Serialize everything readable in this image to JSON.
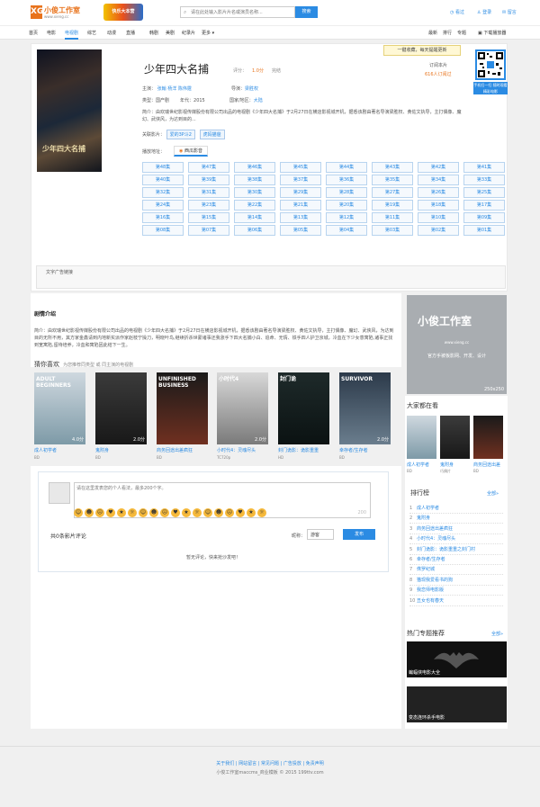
{
  "header": {
    "logo_text": "小俊工作室",
    "logo_sub": "www.xieng.cc",
    "banner_text": "快乐大本营",
    "search_placeholder": "请在此处输入影片片名或演员名称...",
    "search_button": "搜索",
    "links": [
      "看过",
      "登录",
      "留言"
    ]
  },
  "nav": {
    "items": [
      "首页",
      "电影",
      "电视剧",
      "综艺",
      "动漫",
      "直播",
      "韩剧",
      "美剧",
      "纪录片",
      "更多 ▾"
    ],
    "active": "电视剧",
    "right": [
      "最新",
      "排行",
      "专题",
      "下载播放器"
    ]
  },
  "detail": {
    "title": "少年四大名捕",
    "poster_text": "少年四大名捕",
    "score_label": "评分：",
    "score": "1.0分",
    "status": "完结",
    "remind": "一键收藏，每天提醒更新",
    "subs_label": "订阅本片",
    "subs_count": "616人订阅过",
    "qr_label": "手机扫一扫 随时观看精彩电影",
    "cast_label": "主演：",
    "cast": [
      "张翰",
      "杨洋",
      "陈伟霆"
    ],
    "director_label": "导演：",
    "director": "梁胜权",
    "type_label": "类型：",
    "type": "国产剧",
    "year_label": "年代：",
    "year": "2015",
    "region_label": "国家/地区：",
    "region": "大陆",
    "intro": "简介：由欢瑞世纪影视传媒股份有限公司出品的电视剧《少年四大名捕》于2月27日在横店影视城开机，据悉该剧由著名导演梁胜权、黄佐文执导，主打偶像、魔幻、武侠风，为达到目的...",
    "related_label": "关联影片：",
    "related": [
      "爱的3P斗2",
      "虎妈猫爸"
    ],
    "source_label": "播放地址：",
    "source": "西瓜影音",
    "episodes": [
      "第48集",
      "第47集",
      "第46集",
      "第45集",
      "第44集",
      "第43集",
      "第42集",
      "第41集",
      "第40集",
      "第39集",
      "第38集",
      "第37集",
      "第36集",
      "第35集",
      "第34集",
      "第33集",
      "第32集",
      "第31集",
      "第30集",
      "第29集",
      "第28集",
      "第27集",
      "第26集",
      "第25集",
      "第24集",
      "第23集",
      "第22集",
      "第21集",
      "第20集",
      "第19集",
      "第18集",
      "第17集",
      "第16集",
      "第15集",
      "第14集",
      "第13集",
      "第12集",
      "第11集",
      "第10集",
      "第09集",
      "第08集",
      "第07集",
      "第06集",
      "第05集",
      "第04集",
      "第03集",
      "第02集",
      "第01集"
    ],
    "ad_text": "文字广告链接"
  },
  "plot": {
    "heading": "剧情介绍",
    "text": "简介：由欢瑞世纪影视传媒股份有限公司出品的电视剧《少年四大名捕》于2月27日在横店影视城开机，据悉该剧由著名导演梁胜权、黄佐文执导，主打偶像、魔幻、武侠风，为达到目的无所不用，其方家金鑫请到内地新实派作家赵枝宁操刀，明晓叶鸟,继续折杀世蒙诸事还我涨手下四大名捕小白、追命、无情、铁手四人护卫京城，冷血在下少女意寓陷,诸事正找到宽寓陷,留待培养，冷血和寓陷因此结下一生。"
  },
  "like": {
    "heading": "猜你喜欢",
    "sub": "为您推荐同类型 或 同主演的电视剧",
    "items": [
      {
        "name": "成人初学者",
        "cap": "ADULT BEGINNERS",
        "score": "4.0分",
        "quality": "BD"
      },
      {
        "name": "鬼附身",
        "cap": "",
        "score": "2.0分",
        "quality": "BD"
      },
      {
        "name": "商务回途出差疯狂",
        "cap": "UNFINISHED BUSINESS",
        "score": "",
        "quality": "BD"
      },
      {
        "name": "小时代4：灵魂尽头",
        "cap": "小时代4",
        "score": "2.0分",
        "quality": "TC720p"
      },
      {
        "name": "封门诡影：诡影重重",
        "cap": "封门诡",
        "score": "",
        "quality": "HD"
      },
      {
        "name": "幸存者/生存者",
        "cap": "SURVIVOR",
        "score": "2.0分",
        "quality": "BD"
      }
    ]
  },
  "comments": {
    "placeholder": "请在这里发表您的个人看法，最多200个字。",
    "limit": "200",
    "count_label": "共0条影片评论",
    "nick_label": "昵称：",
    "nick_value": "游客",
    "submit": "发布",
    "empty": "暂无评论，快来抢沙发吧！",
    "emoji_count": 18
  },
  "sidebar": {
    "ad_logo": "小俊工作室",
    "ad_url": "www.xieng.cc",
    "ad_slogan": "官方手被板影网、开发、设计",
    "ad_size": "250x250",
    "watching_heading": "大家都在看",
    "watching": [
      {
        "name": "成人初学者",
        "quality": "BD"
      },
      {
        "name": "鬼附身",
        "quality": "巧偶片"
      },
      {
        "name": "商务回途出差",
        "quality": "BD"
      }
    ],
    "rank_heading": "排行榜",
    "rank_more": "全部»",
    "rank": [
      "成人初学者",
      "鬼附身",
      "商务回途出差疯狂",
      "小时代4：灵魂尽头",
      "封门诡影：诡影重重之封门村",
      "幸存者/生存者",
      "侏罗纪城",
      "猫现我爱看书的狗",
      "我恋师电影版",
      "丑女也有春天"
    ],
    "topics_heading": "热门专题推荐",
    "topics_more": "全部»",
    "topics": [
      "蝙蝠侠电影大全",
      "变态连环杀手电影"
    ]
  },
  "footer": {
    "links": "关于我们 | 网站留言 | 常见问题 | 广告投放 | 免责声明",
    "copy": "小俊工作室maccms_商业模板 © 2015 199ttv.com"
  }
}
